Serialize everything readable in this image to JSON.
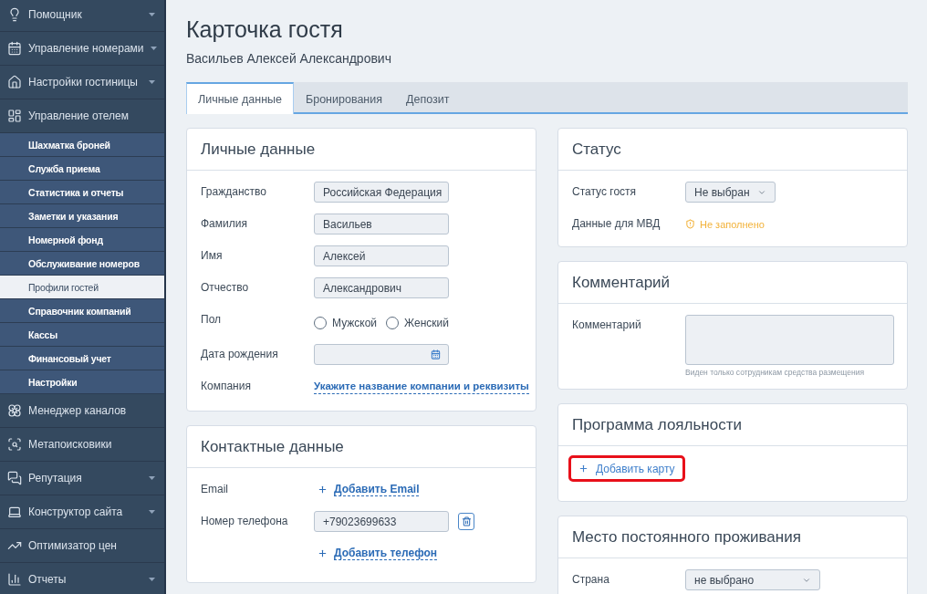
{
  "sidebar": {
    "items": [
      {
        "label": "Помощник",
        "dropdown": true
      },
      {
        "label": "Управление номерами",
        "dropdown": true
      },
      {
        "label": "Настройки гостиницы",
        "dropdown": true
      },
      {
        "label": "Управление отелем",
        "dropdown": false,
        "children": [
          {
            "label": "Шахматка броней",
            "selected": false
          },
          {
            "label": "Служба приема",
            "selected": false
          },
          {
            "label": "Статистика и отчеты",
            "selected": false
          },
          {
            "label": "Заметки и указания",
            "selected": false
          },
          {
            "label": "Номерной фонд",
            "selected": false
          },
          {
            "label": "Обслуживание номеров",
            "selected": false
          },
          {
            "label": "Профили гостей",
            "selected": true
          },
          {
            "label": "Справочник компаний",
            "selected": false
          },
          {
            "label": "Кассы",
            "selected": false
          },
          {
            "label": "Финансовый учет",
            "selected": false
          },
          {
            "label": "Настройки",
            "selected": false
          }
        ]
      },
      {
        "label": "Менеджер каналов",
        "dropdown": false
      },
      {
        "label": "Метапоисковики",
        "dropdown": false
      },
      {
        "label": "Репутация",
        "dropdown": true
      },
      {
        "label": "Конструктор сайта",
        "dropdown": true
      },
      {
        "label": "Оптимизатор цен",
        "dropdown": false
      },
      {
        "label": "Отчеты",
        "dropdown": true
      }
    ]
  },
  "page": {
    "title": "Карточка гостя",
    "subtitle": "Васильев Алексей Александрович"
  },
  "tabs": [
    {
      "label": "Личные данные",
      "selected": true
    },
    {
      "label": "Бронирования",
      "selected": false
    },
    {
      "label": "Депозит",
      "selected": false
    }
  ],
  "personal_data": {
    "title": "Личные данные",
    "rows": [
      {
        "kind": "select",
        "label": "Гражданство",
        "value": "Российская Федерация"
      },
      {
        "kind": "input",
        "label": "Фамилия",
        "value": "Васильев"
      },
      {
        "kind": "input",
        "label": "Имя",
        "value": "Алексей"
      },
      {
        "kind": "input",
        "label": "Отчество",
        "value": "Александрович"
      },
      {
        "kind": "radio",
        "label": "Пол",
        "options": [
          {
            "label": "Мужской",
            "checked": false
          },
          {
            "label": "Женский",
            "checked": false
          }
        ]
      },
      {
        "kind": "date",
        "label": "Дата рождения"
      },
      {
        "kind": "link",
        "label": "Компания",
        "text": "Укажите название компании и реквизиты"
      }
    ]
  },
  "contacts": {
    "title": "Контактные данные",
    "rows": [
      {
        "kind": "add_link",
        "label": "Email",
        "text": "Добавить Email"
      },
      {
        "kind": "phone",
        "label": "Номер телефона",
        "value": "+79023699633"
      },
      {
        "kind": "add_link",
        "text": "Добавить телефон"
      }
    ]
  },
  "status": {
    "title": "Статус",
    "rows": [
      {
        "kind": "select",
        "label": "Статус гостя",
        "value": "Не выбран"
      },
      {
        "kind": "warning",
        "label": "Данные для МВД",
        "text": "Не заполнено"
      }
    ]
  },
  "comment": {
    "title": "Комментарий",
    "rows": [
      {
        "kind": "textarea",
        "label": "Комментарий",
        "hint": "Виден только сотрудникам средства размещения"
      }
    ]
  },
  "loyalty": {
    "title": "Программа лояльности",
    "add_button": {
      "text": "Добавить карту",
      "highlighted": true
    }
  },
  "residence": {
    "title": "Место постоянного проживания",
    "rows": [
      {
        "kind": "select",
        "label": "Страна",
        "value": "не выбрано"
      }
    ]
  }
}
